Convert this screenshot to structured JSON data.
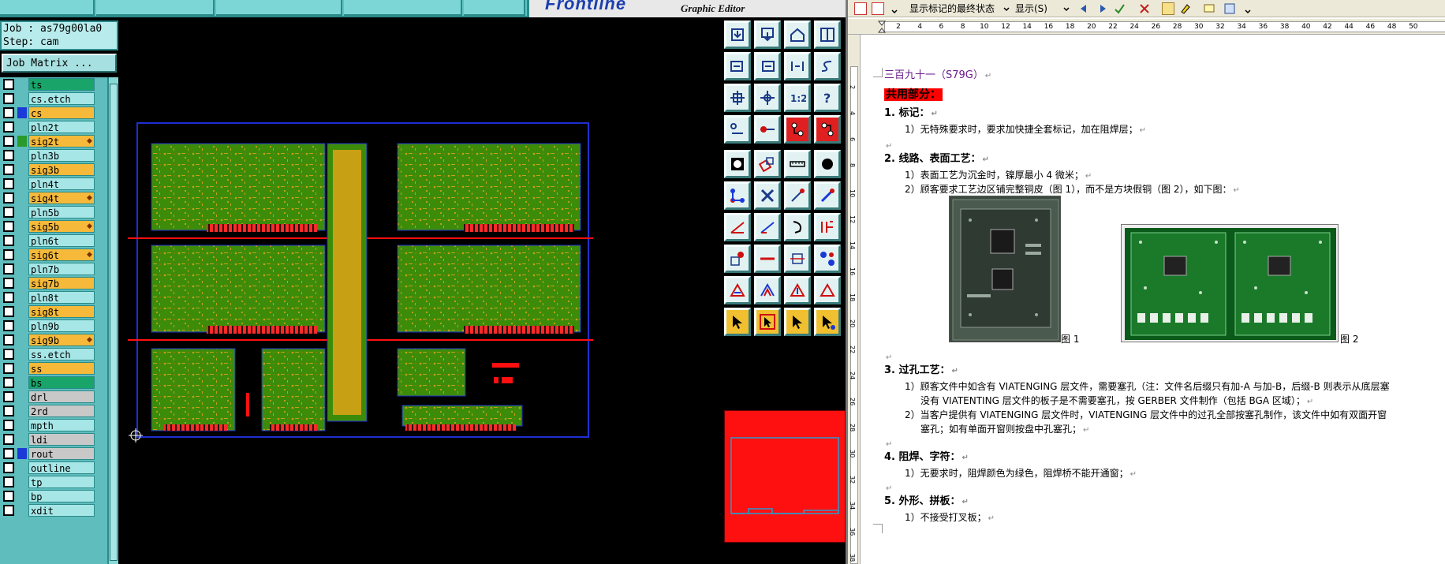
{
  "cam": {
    "brand_logo": "Frontline",
    "brand_sub": "Graphic Editor",
    "job_line": "Job : as79g00la0",
    "step_line": "Step: cam",
    "job_matrix_button": "Job Matrix ...",
    "layers": [
      {
        "name": "ts",
        "style": "green"
      },
      {
        "name": "cs.etch",
        "style": "cyan"
      },
      {
        "name": "cs",
        "style": "orange",
        "selected": true,
        "color": "#1b3ad8"
      },
      {
        "name": "pln2t",
        "style": "cyan"
      },
      {
        "name": "sig2t",
        "style": "orange",
        "color": "#2a9a2a",
        "flag": true
      },
      {
        "name": "pln3b",
        "style": "cyan"
      },
      {
        "name": "sig3b",
        "style": "orange"
      },
      {
        "name": "pln4t",
        "style": "cyan"
      },
      {
        "name": "sig4t",
        "style": "orange",
        "flag": true
      },
      {
        "name": "pln5b",
        "style": "cyan"
      },
      {
        "name": "sig5b",
        "style": "orange",
        "flag": true
      },
      {
        "name": "pln6t",
        "style": "cyan"
      },
      {
        "name": "sig6t",
        "style": "orange",
        "flag": true
      },
      {
        "name": "pln7b",
        "style": "cyan"
      },
      {
        "name": "sig7b",
        "style": "orange"
      },
      {
        "name": "pln8t",
        "style": "cyan"
      },
      {
        "name": "sig8t",
        "style": "orange"
      },
      {
        "name": "pln9b",
        "style": "cyan"
      },
      {
        "name": "sig9b",
        "style": "orange",
        "flag": true
      },
      {
        "name": "ss.etch",
        "style": "cyan"
      },
      {
        "name": "ss",
        "style": "orange"
      },
      {
        "name": "bs",
        "style": "green"
      },
      {
        "name": "drl",
        "style": "gray"
      },
      {
        "name": "2rd",
        "style": "gray"
      },
      {
        "name": "mpth",
        "style": "cyan"
      },
      {
        "name": "ldi",
        "style": "gray"
      },
      {
        "name": "rout",
        "style": "gray",
        "color": "#1b3ad8"
      },
      {
        "name": "outline",
        "style": "cyan"
      },
      {
        "name": "tp",
        "style": "cyan"
      },
      {
        "name": "bp",
        "style": "cyan"
      },
      {
        "name": "xdit",
        "style": "cyan"
      }
    ],
    "colors": {
      "board_green": "#3c8c0a",
      "board_yellow": "#c8a014",
      "outline_blue": "#1f2fd0",
      "rail_red": "#ff1010"
    }
  },
  "word": {
    "toolbar": {
      "markup_view": "显示标记的最终状态",
      "show_menu": "显示(S)"
    },
    "ruler_ticks": [
      "2",
      "4",
      "6",
      "8",
      "10",
      "12",
      "14",
      "16",
      "18",
      "20",
      "22",
      "24",
      "26",
      "28",
      "30",
      "32",
      "34",
      "36",
      "38",
      "40",
      "42",
      "44",
      "46",
      "48",
      "50"
    ],
    "vruler_ticks": [
      "2",
      "4",
      "6",
      "8",
      "10",
      "12",
      "14",
      "16",
      "18",
      "20",
      "22",
      "24",
      "26",
      "28",
      "30",
      "32",
      "34",
      "36",
      "38"
    ],
    "doc": {
      "title": "三百九十一（S79G）",
      "section": "共用部分：",
      "h1": "1.   标记：",
      "h1_l1": "1）无特殊要求时，要求加快捷全套标记，加在阻焊层；",
      "h2": "2.   线路、表面工艺：",
      "h2_l1": "1）表面工艺为沉金时，镍厚最小 4 微米；",
      "h2_l2": "2）顾客要求工艺边区铺完整铜皮（图 1），而不是方块假铜（图 2），如下图：",
      "fig1_caption": "图 1",
      "fig2_caption": "图 2",
      "h3": "3.   过孔工艺：",
      "h3_l1": "1）顾客文件中如含有 VIATENGING 层文件，需要塞孔（注：文件名后缀只有加-A 与加-B，后缀-B 则表示从底层塞",
      "h3_l1b": "没有 VIATENTING 层文件的板子是不需要塞孔，按 GERBER 文件制作（包括 BGA 区域）；",
      "h3_l2": "2）当客户提供有 VIATENGING 层文件时，VIATENGING 层文件中的过孔全部按塞孔制作，该文件中如有双面开窗",
      "h3_l2b": "塞孔；如有单面开窗则按盘中孔塞孔；",
      "h4": "4.   阻焊、字符：",
      "h4_l1": "1）无要求时，阻焊颜色为绿色，阻焊桥不能开通窗；",
      "h5": "5.   外形、拼板：",
      "h5_l1": "1）不接受打叉板；"
    }
  }
}
